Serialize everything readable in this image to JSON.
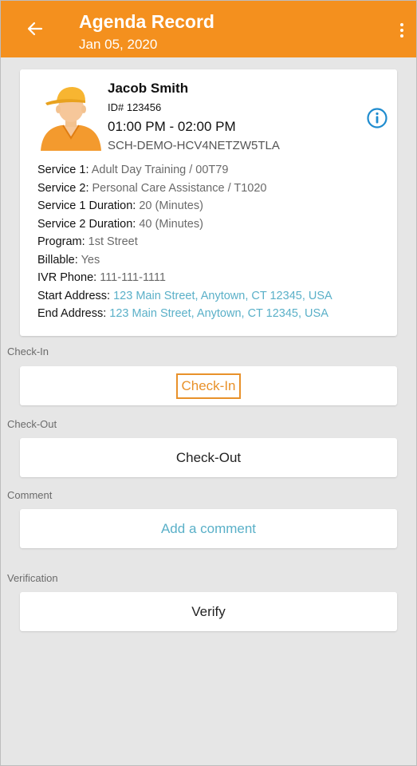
{
  "colors": {
    "appbar": "#f4901e",
    "background": "#e6e6e6",
    "link": "#5ab0c8",
    "highlight": "#e8912a"
  },
  "header": {
    "title": "Agenda Record",
    "subtitle": "Jan 05, 2020",
    "back_icon": "back-arrow-icon",
    "menu_icon": "more-vertical-icon"
  },
  "record": {
    "name": "Jacob Smith",
    "id": "ID# 123456",
    "time": "01:00 PM - 02:00 PM",
    "schedule_code": "SCH-DEMO-HCV4NETZW5TLA",
    "info_icon": "info-icon",
    "details": [
      {
        "label": "Service 1:",
        "value": "Adult Day Training / 00T79"
      },
      {
        "label": "Service 2:",
        "value": "Personal Care Assistance / T1020"
      },
      {
        "label": "Service 1 Duration:",
        "value": "20 (Minutes)"
      },
      {
        "label": "Service 2 Duration:",
        "value": "40 (Minutes)"
      },
      {
        "label": "Program:",
        "value": "1st Street"
      },
      {
        "label": "Billable:",
        "value": "Yes"
      },
      {
        "label": "IVR Phone:",
        "value": "111-111-1111"
      },
      {
        "label": "Start Address:",
        "value": "123 Main Street, Anytown, CT 12345, USA"
      },
      {
        "label": "End Address:",
        "value": "123 Main Street, Anytown, CT 12345, USA"
      }
    ]
  },
  "sections": {
    "checkin": {
      "label": "Check-In",
      "button": "Check-In"
    },
    "checkout": {
      "label": "Check-Out",
      "button": "Check-Out"
    },
    "comment": {
      "label": "Comment",
      "button": "Add a comment"
    },
    "verification": {
      "label": "Verification",
      "button": "Verify"
    }
  }
}
